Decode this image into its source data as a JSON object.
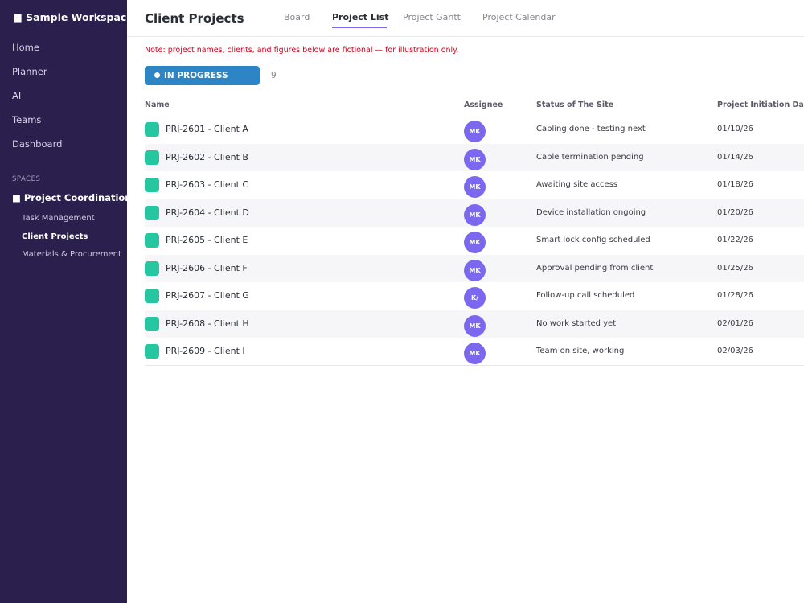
{
  "sidebar": {
    "workspace": "■ Sample Workspace",
    "nav": [
      "Home",
      "Planner",
      "AI",
      "Teams",
      "Dashboard"
    ],
    "spaces_label": "SPACES",
    "space_name": "■ Project Coordination",
    "sub_items": [
      "Task Management",
      "Client Projects",
      "Materials & Procurement"
    ],
    "active_sub_item": "Client Projects"
  },
  "header": {
    "title": "Client Projects",
    "tabs": [
      "Board",
      "Project List",
      "Project Gantt",
      "Project Calendar"
    ],
    "active_tab": "Project List"
  },
  "note": "Note: project names, clients, and figures below are fictional — for illustration only.",
  "group": {
    "status": "IN PROGRESS",
    "count": "9",
    "color": "#2d85c6"
  },
  "columns": {
    "name": "Name",
    "assignee": "Assignee",
    "site_status": "Status of The Site",
    "initiation_date": "Project Initiation Da"
  },
  "colors": {
    "sidebar_bg": "#2a1f4d",
    "accent": "#7b68ee",
    "task_status": "#26c6a0",
    "note_text": "#d0021b"
  },
  "rows": [
    {
      "name": "PRJ-2601 - Client A",
      "assignee": "MK",
      "site_status": "Cabling done - testing next",
      "date": "01/10/26"
    },
    {
      "name": "PRJ-2602 - Client B",
      "assignee": "MK",
      "site_status": "Cable termination pending",
      "date": "01/14/26"
    },
    {
      "name": "PRJ-2603 - Client C",
      "assignee": "MK",
      "site_status": "Awaiting site access",
      "date": "01/18/26"
    },
    {
      "name": "PRJ-2604 - Client D",
      "assignee": "MK",
      "site_status": "Device installation ongoing",
      "date": "01/20/26"
    },
    {
      "name": "PRJ-2605 - Client E",
      "assignee": "MK",
      "site_status": "Smart lock config scheduled",
      "date": "01/22/26"
    },
    {
      "name": "PRJ-2606 - Client F",
      "assignee": "MK",
      "site_status": "Approval pending from client",
      "date": "01/25/26"
    },
    {
      "name": "PRJ-2607 - Client G",
      "assignee": "K/",
      "site_status": "Follow-up call scheduled",
      "date": "01/28/26"
    },
    {
      "name": "PRJ-2608 - Client H",
      "assignee": "MK",
      "site_status": "No work started yet",
      "date": "02/01/26"
    },
    {
      "name": "PRJ-2609 - Client I",
      "assignee": "MK",
      "site_status": "Team on site, working",
      "date": "02/03/26"
    }
  ]
}
